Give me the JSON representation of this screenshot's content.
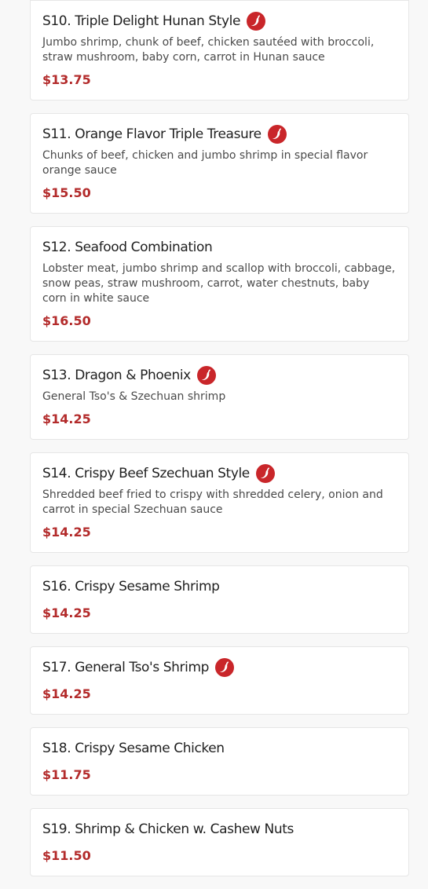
{
  "colors": {
    "accent": "#b32b2b",
    "icon": "#c9262a",
    "title": "#1f1f1f",
    "desc": "#4a4a4a",
    "background": "#f8f8f8"
  },
  "items": [
    {
      "title": "S10. Triple Delight Hunan Style",
      "spicy": true,
      "desc": "Jumbo shrimp, chunk of beef, chicken sautéed with broccoli, straw mushroom, baby corn, carrot in Hunan sauce",
      "price": "$13.75"
    },
    {
      "title": "S11. Orange Flavor Triple Treasure",
      "spicy": true,
      "desc": "Chunks of beef, chicken and jumbo shrimp in special flavor orange sauce",
      "price": "$15.50"
    },
    {
      "title": "S12. Seafood Combination",
      "spicy": false,
      "desc": "Lobster meat, jumbo shrimp and scallop with broccoli, cabbage, snow peas, straw mushroom, carrot, water chestnuts, baby corn in white sauce",
      "price": "$16.50"
    },
    {
      "title": "S13. Dragon & Phoenix",
      "spicy": true,
      "desc": "General Tso's & Szechuan shrimp",
      "price": "$14.25"
    },
    {
      "title": "S14. Crispy Beef Szechuan Style",
      "spicy": true,
      "desc": "Shredded beef fried to crispy with shredded celery, onion and carrot in special Szechuan sauce",
      "price": "$14.25"
    },
    {
      "title": "S16. Crispy Sesame Shrimp",
      "spicy": false,
      "desc": "",
      "price": "$14.25"
    },
    {
      "title": "S17. General Tso's Shrimp",
      "spicy": true,
      "desc": "",
      "price": "$14.25"
    },
    {
      "title": "S18. Crispy Sesame Chicken",
      "spicy": false,
      "desc": "",
      "price": "$11.75"
    },
    {
      "title": "S19. Shrimp & Chicken w. Cashew Nuts",
      "spicy": false,
      "desc": "",
      "price": "$11.50"
    }
  ]
}
